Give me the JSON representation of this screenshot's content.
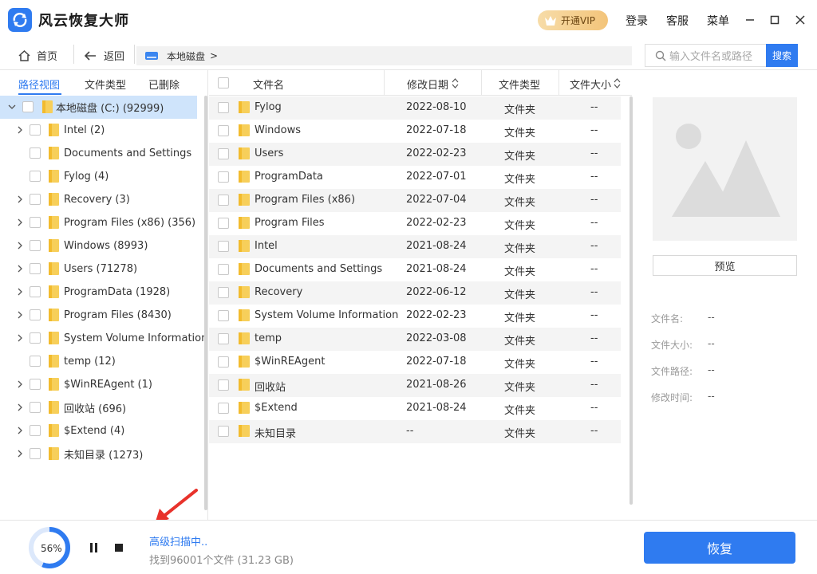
{
  "app": {
    "title": "风云恢复大师"
  },
  "titlebar": {
    "vip_label": "开通VIP",
    "login": "登录",
    "service": "客服",
    "menu": "菜单"
  },
  "nav": {
    "home": "首页",
    "back": "返回",
    "path": "本地磁盘",
    "path_sep": ">",
    "search_placeholder": "输入文件名或路径",
    "search_btn": "搜索"
  },
  "tabs": [
    "路径视图",
    "文件类型",
    "已删除"
  ],
  "tree": {
    "root": "本地磁盘 (C:) (92999)",
    "items": [
      {
        "label": "Intel (2)",
        "expand": true
      },
      {
        "label": "Documents and Settings",
        "expand": false
      },
      {
        "label": "Fylog (4)",
        "expand": false
      },
      {
        "label": "Recovery (3)",
        "expand": true
      },
      {
        "label": "Program Files (x86) (356)",
        "expand": true
      },
      {
        "label": "Windows (8993)",
        "expand": true
      },
      {
        "label": "Users (71278)",
        "expand": true
      },
      {
        "label": "ProgramData (1928)",
        "expand": true
      },
      {
        "label": "Program Files (8430)",
        "expand": true
      },
      {
        "label": "System Volume Information (",
        "expand": true
      },
      {
        "label": "temp (12)",
        "expand": false
      },
      {
        "label": "$WinREAgent (1)",
        "expand": true
      },
      {
        "label": "回收站 (696)",
        "expand": true
      },
      {
        "label": "$Extend (4)",
        "expand": true
      },
      {
        "label": "未知目录 (1273)",
        "expand": true
      }
    ]
  },
  "table": {
    "headers": {
      "name": "文件名",
      "date": "修改日期",
      "type": "文件类型",
      "size": "文件大小"
    },
    "rows": [
      {
        "name": "Fylog",
        "date": "2022-08-10",
        "type": "文件夹",
        "size": "--"
      },
      {
        "name": "Windows",
        "date": "2022-07-18",
        "type": "文件夹",
        "size": "--"
      },
      {
        "name": "Users",
        "date": "2022-02-23",
        "type": "文件夹",
        "size": "--"
      },
      {
        "name": "ProgramData",
        "date": "2022-07-01",
        "type": "文件夹",
        "size": "--"
      },
      {
        "name": "Program Files (x86)",
        "date": "2022-07-04",
        "type": "文件夹",
        "size": "--"
      },
      {
        "name": "Program Files",
        "date": "2022-02-23",
        "type": "文件夹",
        "size": "--"
      },
      {
        "name": "Intel",
        "date": "2021-08-24",
        "type": "文件夹",
        "size": "--"
      },
      {
        "name": "Documents and Settings",
        "date": "2021-08-24",
        "type": "文件夹",
        "size": "--"
      },
      {
        "name": "Recovery",
        "date": "2022-06-12",
        "type": "文件夹",
        "size": "--"
      },
      {
        "name": "System Volume Information",
        "date": "2022-02-23",
        "type": "文件夹",
        "size": "--"
      },
      {
        "name": "temp",
        "date": "2022-03-08",
        "type": "文件夹",
        "size": "--"
      },
      {
        "name": "$WinREAgent",
        "date": "2022-07-18",
        "type": "文件夹",
        "size": "--"
      },
      {
        "name": "回收站",
        "date": "2021-08-26",
        "type": "文件夹",
        "size": "--"
      },
      {
        "name": "$Extend",
        "date": "2021-08-24",
        "type": "文件夹",
        "size": "--"
      },
      {
        "name": "未知目录",
        "date": "--",
        "type": "文件夹",
        "size": "--"
      }
    ]
  },
  "preview": {
    "button": "预览",
    "fields": [
      {
        "label": "文件名:",
        "value": "--"
      },
      {
        "label": "文件大小:",
        "value": "--"
      },
      {
        "label": "文件路径:",
        "value": "--"
      },
      {
        "label": "修改时间:",
        "value": "--"
      }
    ]
  },
  "footer": {
    "progress_percent": 56,
    "progress_text": "56%",
    "status": "高级扫描中..",
    "found": "找到96001个文件 (31.23 GB)",
    "restore_btn": "恢复"
  },
  "colors": {
    "accent": "#2f7bf0",
    "folder": "#f7cf5a",
    "selected_row": "#cfe4fb",
    "annotation_arrow": "#e8322b"
  }
}
